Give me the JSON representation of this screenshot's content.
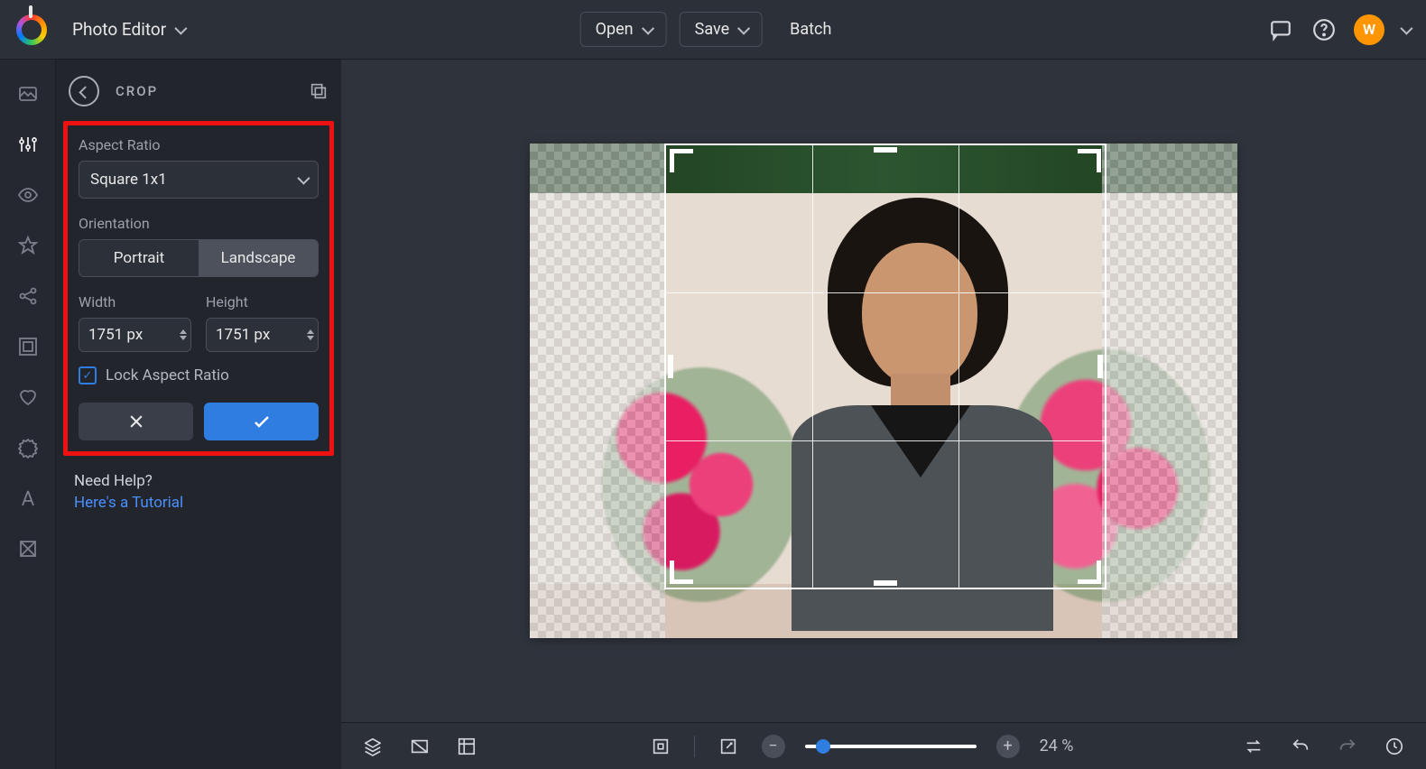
{
  "header": {
    "app_title": "Photo Editor",
    "open": "Open",
    "save": "Save",
    "batch": "Batch",
    "avatar_initial": "W"
  },
  "panel": {
    "title": "CROP",
    "aspect_ratio_label": "Aspect Ratio",
    "aspect_ratio_value": "Square 1x1",
    "orientation_label": "Orientation",
    "orientation_options": {
      "portrait": "Portrait",
      "landscape": "Landscape"
    },
    "width_label": "Width",
    "height_label": "Height",
    "width_value": "1751 px",
    "height_value": "1751 px",
    "lock_label": "Lock Aspect Ratio",
    "lock_checked": true
  },
  "help": {
    "question": "Need Help?",
    "link": "Here's a Tutorial"
  },
  "bottombar": {
    "zoom_value": "24 %"
  }
}
